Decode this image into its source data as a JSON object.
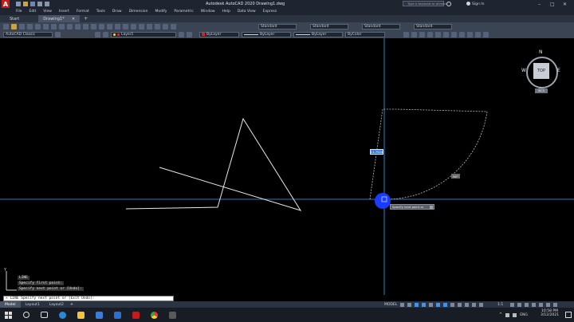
{
  "titlebar": {
    "app_title": "Autodesk AutoCAD 2020   Drawing1.dwg",
    "search_placeholder": "Type a keyword or phrase",
    "sign_in": "Sign In"
  },
  "menu": [
    "File",
    "Edit",
    "View",
    "Insert",
    "Format",
    "Tools",
    "Draw",
    "Dimension",
    "Modify",
    "Parametric",
    "Window",
    "Help",
    "Data View",
    "Express"
  ],
  "file_tabs": [
    {
      "label": "Start",
      "active": false
    },
    {
      "label": "Drawing1*",
      "active": true
    }
  ],
  "toolbar": {
    "workspace": "AutoCAD Classic",
    "layer": "Layer1",
    "color": "ByLayer",
    "linetype": "ByLayer",
    "lineweight": "ByLayer",
    "plotstyle": "ByColor",
    "text_style": "Standard",
    "dim_style": "Standard",
    "table_style": "Standard",
    "mleader_style": "Standard"
  },
  "viewcube": {
    "top": "TOP",
    "north": "N",
    "south": "S",
    "east": "E",
    "west": "W",
    "wcs": "WCS"
  },
  "drawing": {
    "dim_length": "11.7524",
    "dim_angle": "90°",
    "prompt": "Specify next point or"
  },
  "command_history": [
    "LINE",
    "Specify first point:",
    "Specify next point or [Undo]:"
  ],
  "command_line": "LINE Specify next point or [Exit Undo]:",
  "layout_tabs": [
    {
      "label": "Model",
      "active": true
    },
    {
      "label": "Layout1",
      "active": false
    },
    {
      "label": "Layout2",
      "active": false
    }
  ],
  "status": {
    "model": "MODEL",
    "scale": "1:1"
  },
  "clock": {
    "time": "10:58 PM",
    "date": "3/12/2021",
    "lang": "ENG"
  },
  "colors": {
    "crosshair": "#3aa0ff",
    "line": "#e8e8e8",
    "dashed": "#bdbdbd",
    "cursor_dot": "#1a3cff"
  }
}
